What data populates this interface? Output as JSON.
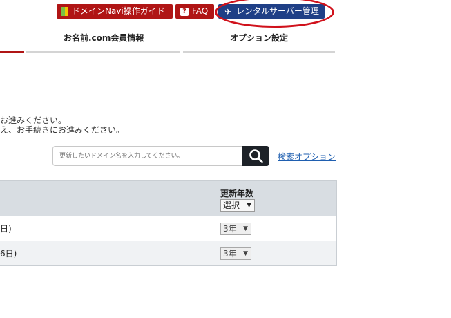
{
  "header": {
    "guide_button": "ドメインNavi操作ガイド",
    "faq_button": "FAQ",
    "server_button": "レンタルサーバー管理"
  },
  "nav": {
    "tabs": [
      {
        "label": "お名前.com会員情報"
      },
      {
        "label": "オプション設定"
      }
    ]
  },
  "instructions": {
    "line1": "お進みください。",
    "line2": "え、お手続きにお進みください。"
  },
  "search": {
    "placeholder": "更新したいドメイン名を入力してください。",
    "options_link": "検索オプション"
  },
  "table": {
    "header": {
      "label": "更新年数",
      "select_value": "選択"
    },
    "rows": [
      {
        "date": "日)",
        "years": "3年"
      },
      {
        "date": "6日)",
        "years": "3年"
      }
    ]
  },
  "colors": {
    "accent_red": "#b01515",
    "navy": "#1f3f86",
    "highlight": "#d0111b"
  }
}
